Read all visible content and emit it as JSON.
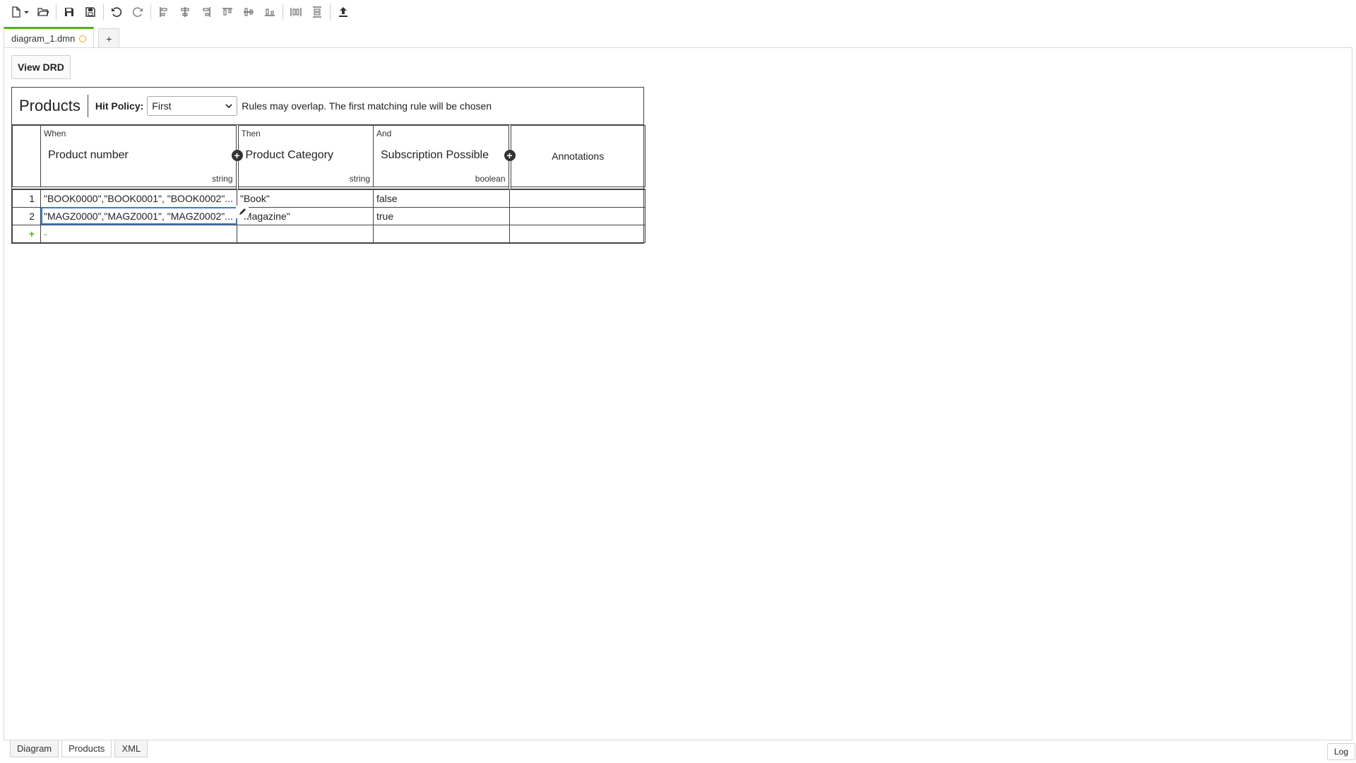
{
  "toolbar": {
    "buttons": [
      {
        "icon": "new-file-icon"
      },
      {
        "icon": "open-folder-icon"
      },
      {
        "icon": "save-icon"
      },
      {
        "icon": "save-as-icon"
      },
      {
        "icon": "undo-icon"
      },
      {
        "icon": "redo-icon"
      },
      {
        "icon": "align-left-icon"
      },
      {
        "icon": "align-center-icon"
      },
      {
        "icon": "align-right-icon"
      },
      {
        "icon": "align-top-icon"
      },
      {
        "icon": "align-middle-icon"
      },
      {
        "icon": "align-bottom-icon"
      },
      {
        "icon": "distribute-horizontal-icon"
      },
      {
        "icon": "distribute-vertical-icon"
      },
      {
        "icon": "deploy-icon"
      }
    ]
  },
  "tabs": {
    "file_tab_label": "diagram_1.dmn",
    "add_tab_label": "+"
  },
  "view_drd_label": "View DRD",
  "decision": {
    "name": "Products",
    "hit_policy_label": "Hit Policy:",
    "hit_policy_value": "First",
    "hit_policy_description": "Rules may overlap. The first matching rule will be chosen",
    "input": {
      "clause": "When",
      "label": "Product number",
      "type": "string"
    },
    "outputs": [
      {
        "clause": "Then",
        "label": "Product Category",
        "type": "string"
      },
      {
        "clause": "And",
        "label": "Subscription Possible",
        "type": "boolean"
      }
    ],
    "annotations_label": "Annotations",
    "rules": [
      {
        "index": "1",
        "input": "\"BOOK0000\",\"BOOK0001\", \"BOOK0002\"...",
        "out1": "\"Book\"",
        "out2": "false",
        "annotation": ""
      },
      {
        "index": "2",
        "input": "\"MAGZ0000\",\"MAGZ0001\", \"MAGZ0002\"...",
        "out1": "\"Magazine\"",
        "out2": "true",
        "annotation": ""
      }
    ],
    "add_rule_label": "+",
    "add_rule_placeholder": "-"
  },
  "bottom_tabs": [
    "Diagram",
    "Products",
    "XML"
  ],
  "active_bottom_tab": "Products",
  "log_label": "Log",
  "colors": {
    "accent_green": "#52b415",
    "dirty_orange": "#f0a020",
    "focus_blue": "#3a7bd5"
  }
}
